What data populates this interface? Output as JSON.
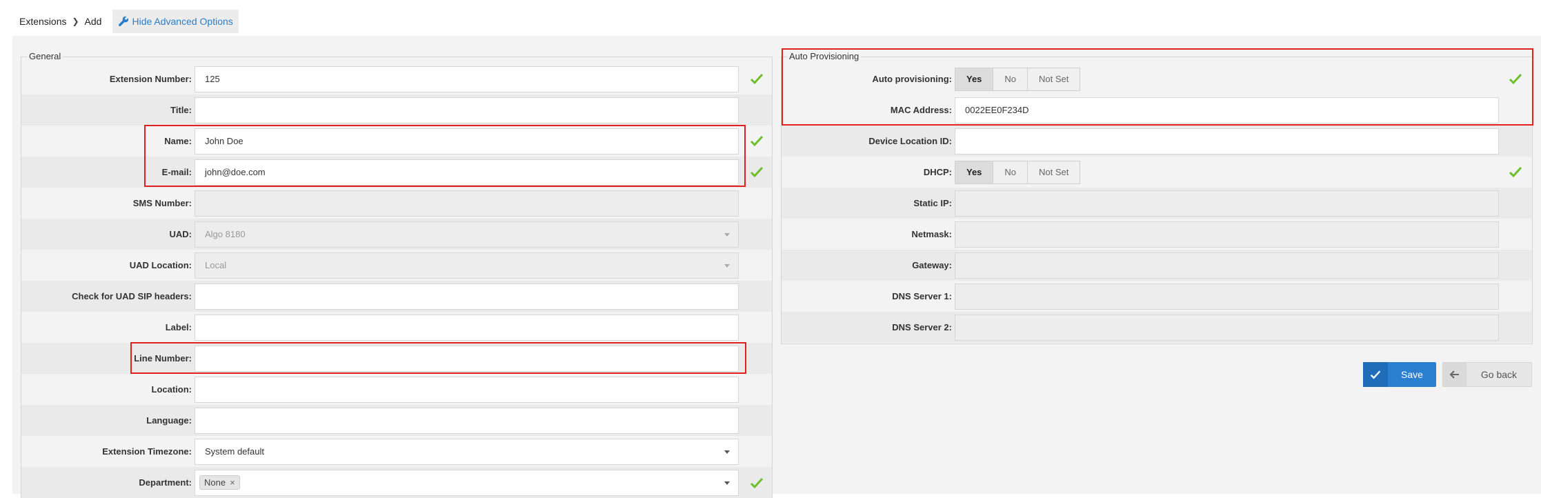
{
  "breadcrumb": {
    "root": "Extensions",
    "current": "Add"
  },
  "advanced_toggle_label": "Hide Advanced Options",
  "general": {
    "legend": "General",
    "extension_number": {
      "label": "Extension Number:",
      "value": "125"
    },
    "title": {
      "label": "Title:",
      "value": ""
    },
    "name": {
      "label": "Name:",
      "value": "John Doe"
    },
    "email": {
      "label": "E-mail:",
      "value": "john@doe.com"
    },
    "sms_number": {
      "label": "SMS Number:",
      "value": ""
    },
    "uad": {
      "label": "UAD:",
      "value": "Algo 8180"
    },
    "uad_location": {
      "label": "UAD Location:",
      "value": "Local"
    },
    "uad_sip_headers": {
      "label": "Check for UAD SIP headers:",
      "value": ""
    },
    "label_field": {
      "label": "Label:",
      "value": ""
    },
    "line_number": {
      "label": "Line Number:",
      "value": ""
    },
    "location": {
      "label": "Location:",
      "value": ""
    },
    "language": {
      "label": "Language:",
      "value": ""
    },
    "timezone": {
      "label": "Extension Timezone:",
      "value": "System default"
    },
    "department": {
      "label": "Department:",
      "tag": "None",
      "tag_remove": "×"
    }
  },
  "auto_provisioning": {
    "legend": "Auto Provisioning",
    "auto_provisioning": {
      "label": "Auto provisioning:",
      "options": [
        "Yes",
        "No",
        "Not Set"
      ],
      "selected": "Yes"
    },
    "mac_address": {
      "label": "MAC Address:",
      "value": "0022EE0F234D"
    },
    "device_location_id": {
      "label": "Device Location ID:",
      "value": ""
    },
    "dhcp": {
      "label": "DHCP:",
      "options": [
        "Yes",
        "No",
        "Not Set"
      ],
      "selected": "Yes"
    },
    "static_ip": {
      "label": "Static IP:",
      "value": ""
    },
    "netmask": {
      "label": "Netmask:",
      "value": ""
    },
    "gateway": {
      "label": "Gateway:",
      "value": ""
    },
    "dns1": {
      "label": "DNS Server 1:",
      "value": ""
    },
    "dns2": {
      "label": "DNS Server 2:",
      "value": ""
    }
  },
  "actions": {
    "save": "Save",
    "go_back": "Go back"
  },
  "colors": {
    "accent": "#2b7fd0",
    "valid": "#6cbf2a",
    "highlight": "#e02020"
  }
}
